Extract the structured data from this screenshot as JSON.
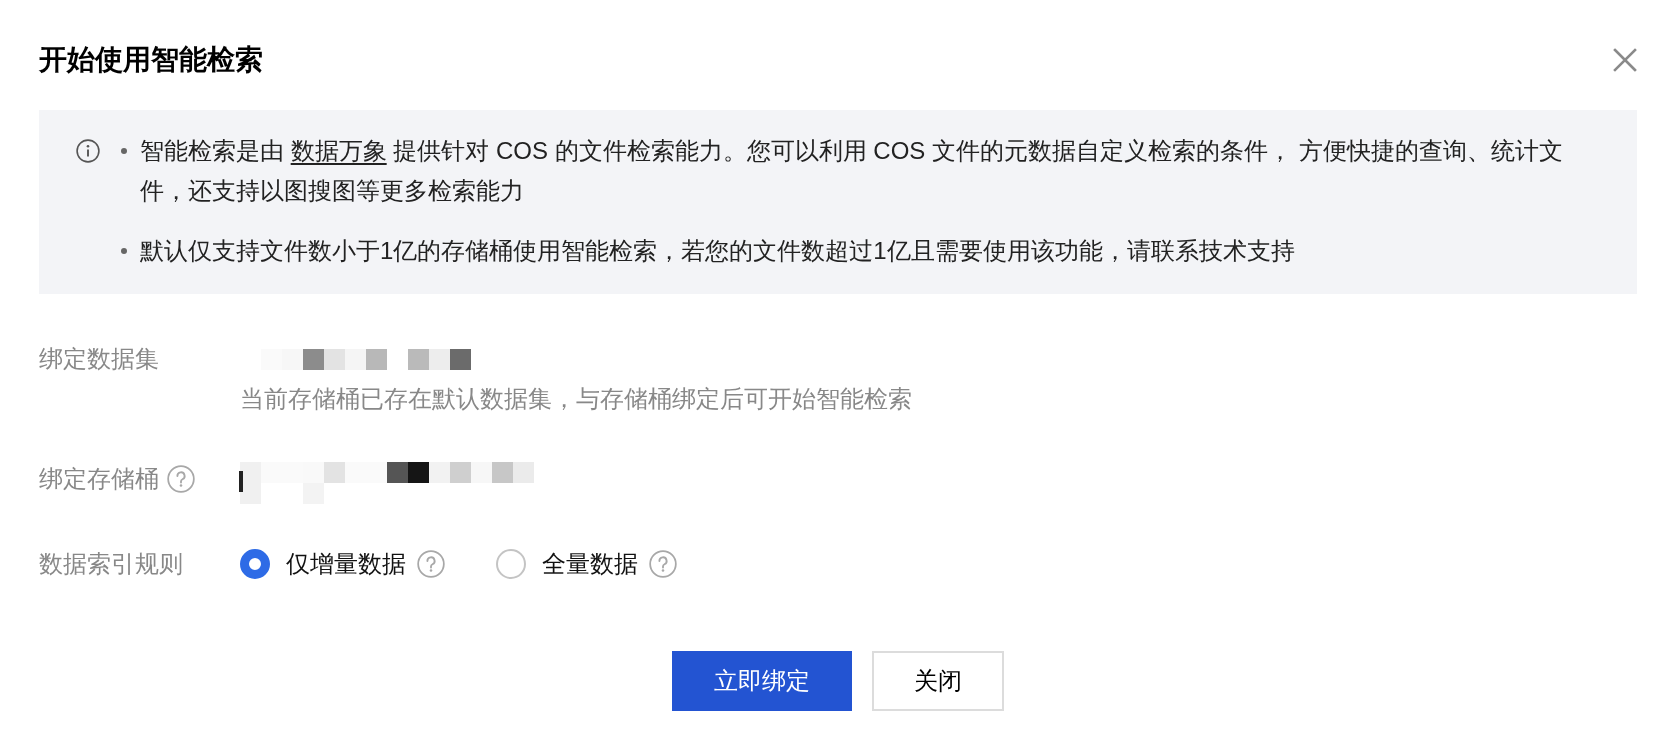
{
  "dialog": {
    "title": "开始使用智能检索"
  },
  "notice": {
    "items": [
      {
        "segments": [
          {
            "kind": "text",
            "text": "智能检索是由 "
          },
          {
            "kind": "link",
            "text": "数据万象"
          },
          {
            "kind": "text",
            "text": " 提供针对 COS 的文件检索能力。您可以利用 COS 文件的元数据自定义检索的条件， 方便快捷的查询、统计文件，还支持以图搜图等更多检索能力"
          }
        ]
      },
      {
        "segments": [
          {
            "kind": "text",
            "text": "默认仅支持文件数小于1亿的存储桶使用智能检索，若您的文件数超过1亿且需要使用该功能，请联系技术支持"
          }
        ]
      }
    ]
  },
  "form": {
    "rows": [
      {
        "kind": "redacted",
        "label": "绑定数据集",
        "help": false,
        "hint": "当前存储桶已存在默认数据集，与存储桶绑定后可开始智能检索"
      },
      {
        "kind": "redacted",
        "label": "绑定存储桶",
        "help": true
      },
      {
        "kind": "radio",
        "label": "数据索引规则",
        "help": false,
        "options": [
          {
            "label": "仅增量数据",
            "selected": true,
            "help": true
          },
          {
            "label": "全量数据",
            "selected": false,
            "help": true
          }
        ]
      }
    ]
  },
  "buttons": [
    {
      "kind": "primary",
      "label": "立即绑定"
    },
    {
      "kind": "secondary",
      "label": "关闭"
    }
  ]
}
